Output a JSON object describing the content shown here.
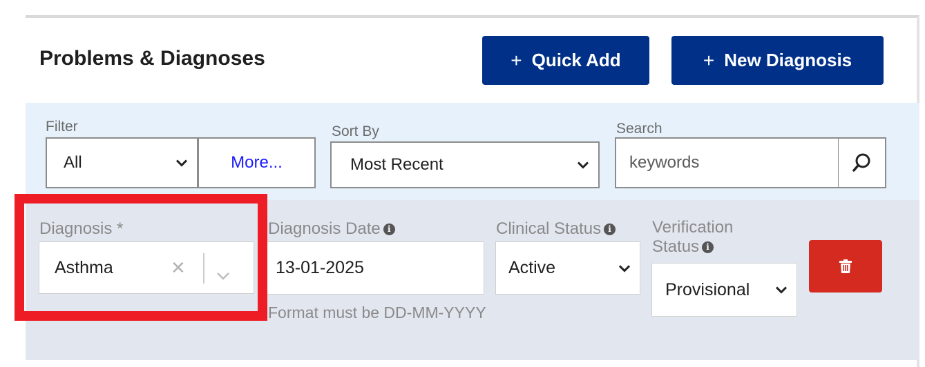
{
  "header": {
    "title": "Problems & Diagnoses",
    "quick_add": {
      "icon": "plus-icon",
      "label": "Quick Add"
    },
    "new_diagnosis": {
      "icon": "plus-icon",
      "label": "New Diagnosis"
    }
  },
  "filters": {
    "filter_label": "Filter",
    "filter_value": "All",
    "more_label": "More...",
    "sort_label": "Sort By",
    "sort_value": "Most Recent",
    "search_label": "Search",
    "search_placeholder": "keywords"
  },
  "diagnosis_row": {
    "diagnosis_label": "Diagnosis *",
    "diagnosis_value": "Asthma",
    "date_label": "Diagnosis Date",
    "date_value": "13-01-2025",
    "date_hint": "Format must be DD-MM-YYYY",
    "clinical_label": "Clinical Status",
    "clinical_value": "Active",
    "verification_label_1": "Verification",
    "verification_label_2": "Status",
    "verification_value": "Provisional"
  },
  "colors": {
    "primary": "#003087",
    "danger": "#d42a1f",
    "highlight": "#ee1c25",
    "filter_bg": "#e6f1fb",
    "row_bg": "#e2e6ef"
  }
}
